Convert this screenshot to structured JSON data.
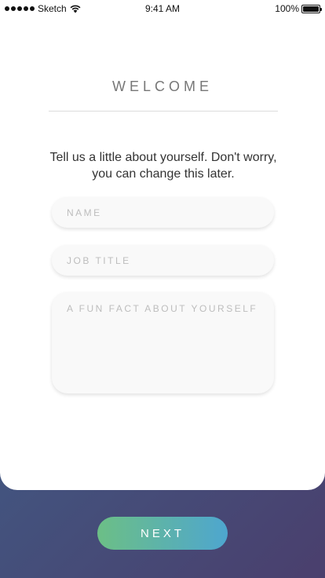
{
  "status_bar": {
    "carrier": "Sketch",
    "time": "9:41 AM",
    "battery": "100%"
  },
  "screen": {
    "title": "WELCOME",
    "subtitle": "Tell us a little about yourself. Don't worry, you can change this later."
  },
  "form": {
    "name_placeholder": "NAME",
    "job_title_placeholder": "JOB TITLE",
    "fun_fact_placeholder": "A FUN FACT ABOUT YOURSELF"
  },
  "actions": {
    "next_label": "NEXT"
  },
  "colors": {
    "background_gradient": [
      "#3a6c93",
      "#4a3f6d"
    ],
    "button_gradient": [
      "#6cbf86",
      "#4ea6cf"
    ]
  }
}
